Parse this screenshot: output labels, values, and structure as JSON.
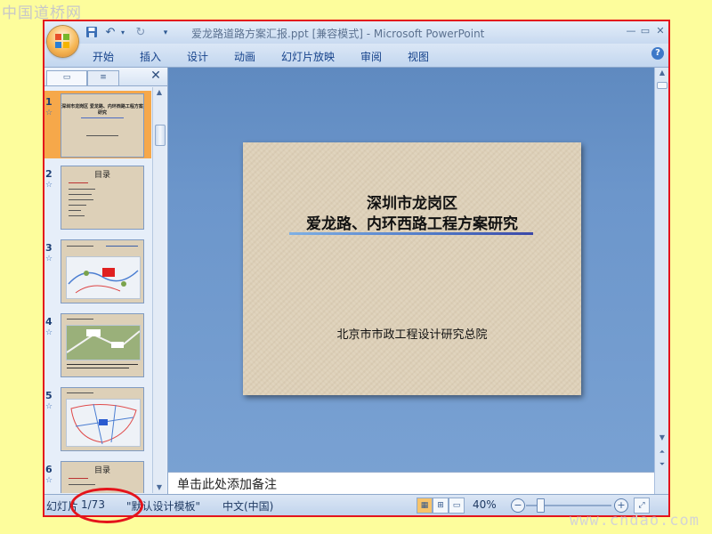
{
  "watermarks": {
    "top": "中国道桥网",
    "bottom": "www.cndao.com"
  },
  "window": {
    "title": "爱龙路道路方案汇报.ppt [兼容模式] - Microsoft PowerPoint"
  },
  "ribbon": {
    "tabs": [
      "开始",
      "插入",
      "设计",
      "动画",
      "幻灯片放映",
      "审阅",
      "视图"
    ]
  },
  "thumbnails": [
    {
      "number": "1",
      "title": "深圳市龙岗区 爱龙路、内环西路工程方案研究"
    },
    {
      "number": "2",
      "title": "目录"
    },
    {
      "number": "3",
      "title": ""
    },
    {
      "number": "4",
      "title": ""
    },
    {
      "number": "5",
      "title": ""
    },
    {
      "number": "6",
      "title": "目录"
    }
  ],
  "slide": {
    "title_line1": "深圳市龙岗区",
    "title_line2": "爱龙路、内环西路工程方案研究",
    "subtitle": "北京市市政工程设计研究总院"
  },
  "notes": {
    "placeholder": "单击此处添加备注"
  },
  "status": {
    "slide_label": "幻灯片",
    "slide_counter": "1/73",
    "template": "\"默认设计模板\"",
    "language": "中文(中国)",
    "zoom": "40%"
  },
  "colors": {
    "highlight_ring": "#e4141b",
    "ribbon_text": "#15428b",
    "rule_end": "#3b48a8"
  }
}
